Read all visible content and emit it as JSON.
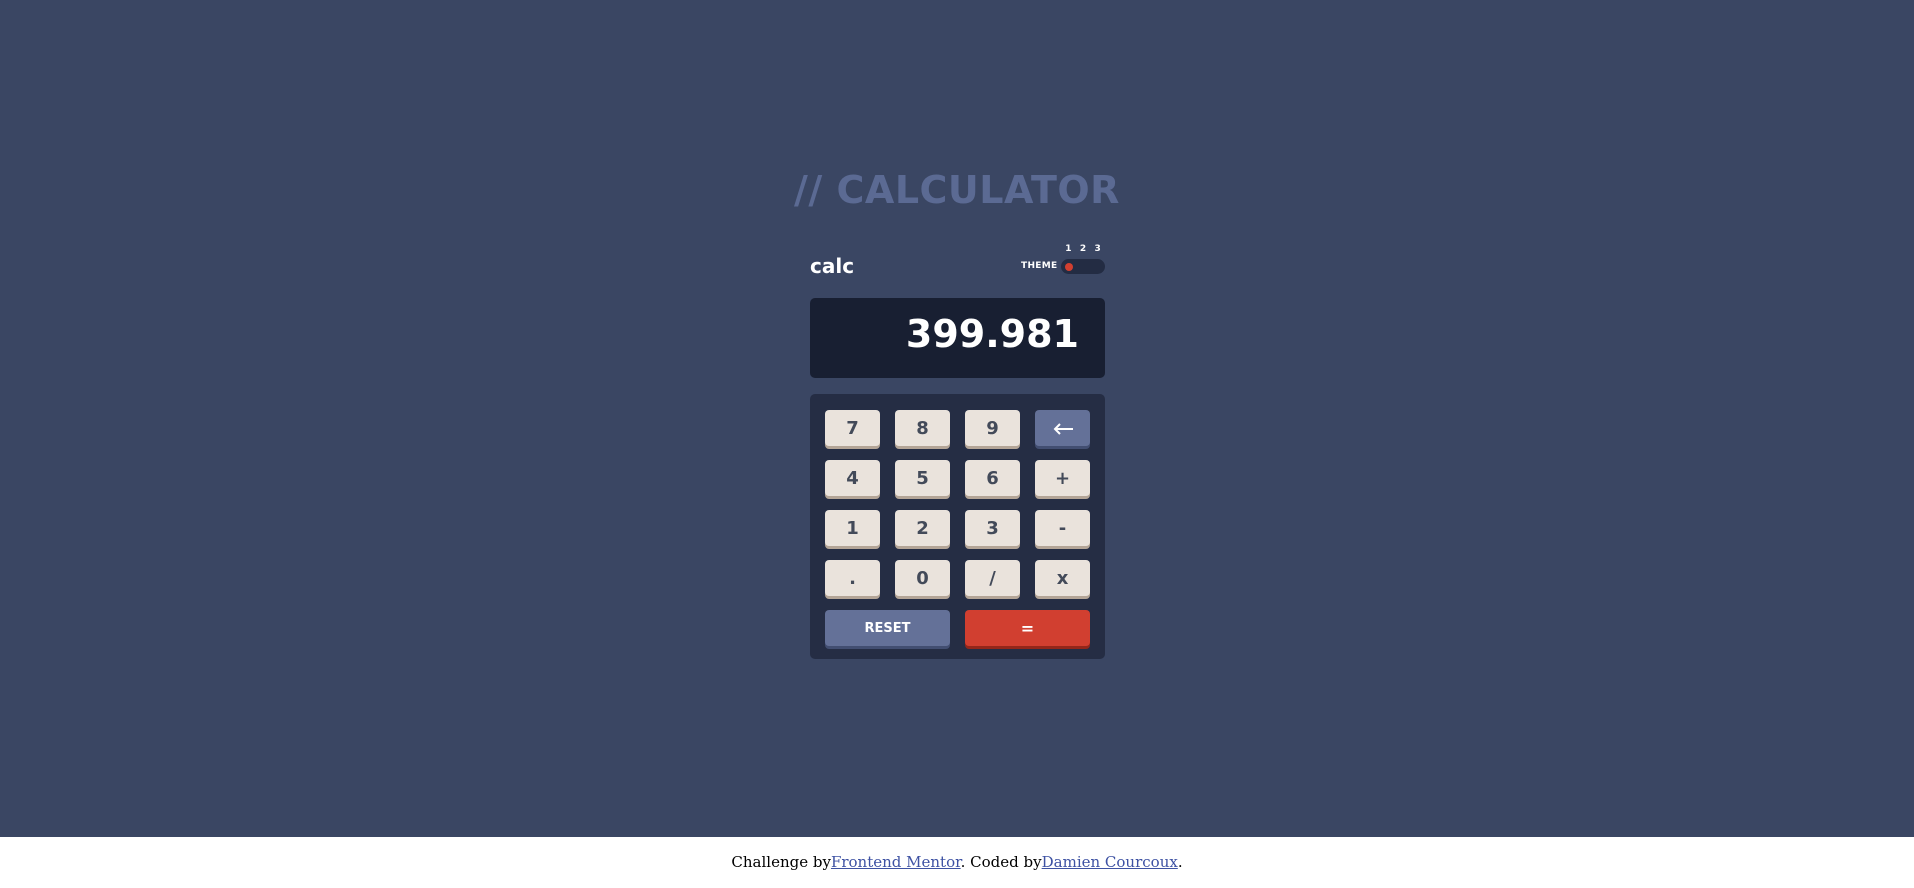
{
  "page": {
    "heading": "// CALCULATOR"
  },
  "header": {
    "logo": "calc",
    "theme_label": "THEME",
    "theme_options": [
      "1",
      "2",
      "3"
    ],
    "theme_selected": "1"
  },
  "screen": {
    "value": "399.981"
  },
  "keypad": {
    "rows": [
      [
        "7",
        "8",
        "9",
        "DEL"
      ],
      [
        "4",
        "5",
        "6",
        "+"
      ],
      [
        "1",
        "2",
        "3",
        "-"
      ],
      [
        ".",
        "0",
        "/",
        "x"
      ]
    ],
    "delete_icon": "arrow-left-icon",
    "reset_label": "RESET",
    "equal_label": "="
  },
  "footer": {
    "prefix": "Challenge by",
    "link1": "Frontend Mentor",
    "middle": ". Coded by",
    "link2": "Damien Courcoux",
    "suffix": "."
  },
  "colors": {
    "background": "#3a4663",
    "screen": "#181f32",
    "keypad": "#252d44",
    "key": "#eae3dc",
    "key_accent": "#647198",
    "equal": "#d13f30"
  }
}
